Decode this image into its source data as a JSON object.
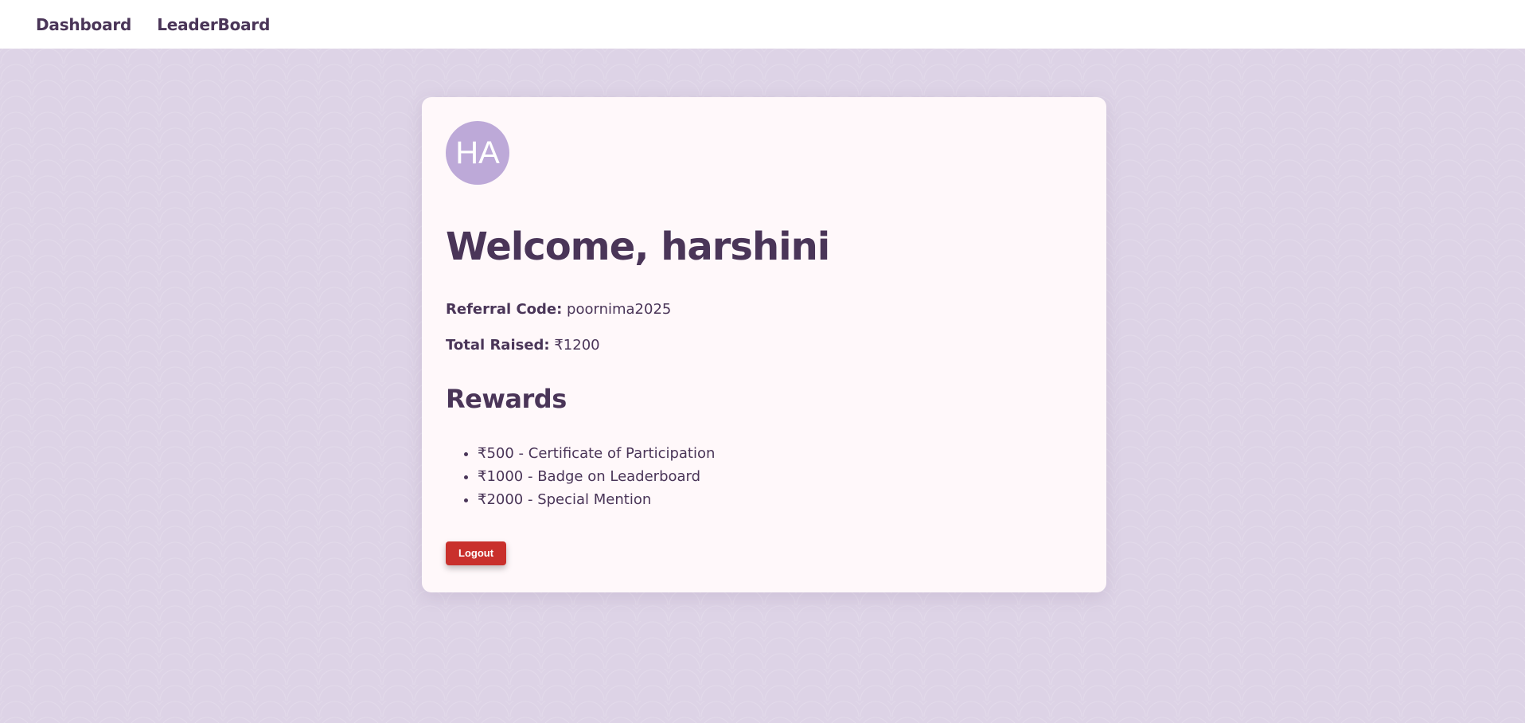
{
  "nav": {
    "items": [
      {
        "label": "Dashboard"
      },
      {
        "label": "LeaderBoard"
      }
    ]
  },
  "profile": {
    "initials": "HA",
    "welcome": "Welcome, harshini",
    "referral_label": "Referral Code:",
    "referral_value": "poornima2025",
    "total_label": "Total Raised:",
    "total_value": "₹1200"
  },
  "rewards": {
    "title": "Rewards",
    "items": [
      "₹500 - Certificate of Participation",
      "₹1000 - Badge on Leaderboard",
      "₹2000 - Special Mention"
    ]
  },
  "actions": {
    "logout_label": "Logout"
  },
  "colors": {
    "primary_text": "#4a3558",
    "avatar_bg": "#bda9d8",
    "logout_bg": "#c9302c",
    "page_bg": "#ddd3e6",
    "card_bg": "#fff8fa"
  }
}
